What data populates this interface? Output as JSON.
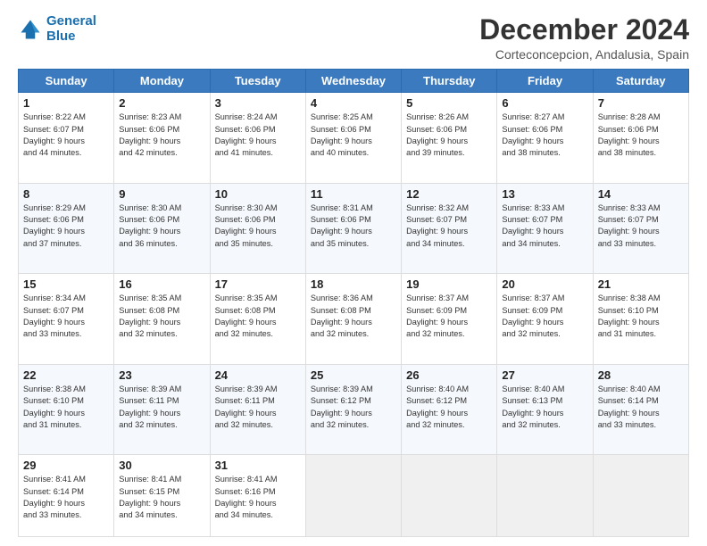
{
  "logo": {
    "line1": "General",
    "line2": "Blue"
  },
  "title": "December 2024",
  "subtitle": "Corteconcepcion, Andalusia, Spain",
  "days_of_week": [
    "Sunday",
    "Monday",
    "Tuesday",
    "Wednesday",
    "Thursday",
    "Friday",
    "Saturday"
  ],
  "weeks": [
    [
      {
        "day": "1",
        "info": "Sunrise: 8:22 AM\nSunset: 6:07 PM\nDaylight: 9 hours\nand 44 minutes."
      },
      {
        "day": "2",
        "info": "Sunrise: 8:23 AM\nSunset: 6:06 PM\nDaylight: 9 hours\nand 42 minutes."
      },
      {
        "day": "3",
        "info": "Sunrise: 8:24 AM\nSunset: 6:06 PM\nDaylight: 9 hours\nand 41 minutes."
      },
      {
        "day": "4",
        "info": "Sunrise: 8:25 AM\nSunset: 6:06 PM\nDaylight: 9 hours\nand 40 minutes."
      },
      {
        "day": "5",
        "info": "Sunrise: 8:26 AM\nSunset: 6:06 PM\nDaylight: 9 hours\nand 39 minutes."
      },
      {
        "day": "6",
        "info": "Sunrise: 8:27 AM\nSunset: 6:06 PM\nDaylight: 9 hours\nand 38 minutes."
      },
      {
        "day": "7",
        "info": "Sunrise: 8:28 AM\nSunset: 6:06 PM\nDaylight: 9 hours\nand 38 minutes."
      }
    ],
    [
      {
        "day": "8",
        "info": "Sunrise: 8:29 AM\nSunset: 6:06 PM\nDaylight: 9 hours\nand 37 minutes."
      },
      {
        "day": "9",
        "info": "Sunrise: 8:30 AM\nSunset: 6:06 PM\nDaylight: 9 hours\nand 36 minutes."
      },
      {
        "day": "10",
        "info": "Sunrise: 8:30 AM\nSunset: 6:06 PM\nDaylight: 9 hours\nand 35 minutes."
      },
      {
        "day": "11",
        "info": "Sunrise: 8:31 AM\nSunset: 6:06 PM\nDaylight: 9 hours\nand 35 minutes."
      },
      {
        "day": "12",
        "info": "Sunrise: 8:32 AM\nSunset: 6:07 PM\nDaylight: 9 hours\nand 34 minutes."
      },
      {
        "day": "13",
        "info": "Sunrise: 8:33 AM\nSunset: 6:07 PM\nDaylight: 9 hours\nand 34 minutes."
      },
      {
        "day": "14",
        "info": "Sunrise: 8:33 AM\nSunset: 6:07 PM\nDaylight: 9 hours\nand 33 minutes."
      }
    ],
    [
      {
        "day": "15",
        "info": "Sunrise: 8:34 AM\nSunset: 6:07 PM\nDaylight: 9 hours\nand 33 minutes."
      },
      {
        "day": "16",
        "info": "Sunrise: 8:35 AM\nSunset: 6:08 PM\nDaylight: 9 hours\nand 32 minutes."
      },
      {
        "day": "17",
        "info": "Sunrise: 8:35 AM\nSunset: 6:08 PM\nDaylight: 9 hours\nand 32 minutes."
      },
      {
        "day": "18",
        "info": "Sunrise: 8:36 AM\nSunset: 6:08 PM\nDaylight: 9 hours\nand 32 minutes."
      },
      {
        "day": "19",
        "info": "Sunrise: 8:37 AM\nSunset: 6:09 PM\nDaylight: 9 hours\nand 32 minutes."
      },
      {
        "day": "20",
        "info": "Sunrise: 8:37 AM\nSunset: 6:09 PM\nDaylight: 9 hours\nand 32 minutes."
      },
      {
        "day": "21",
        "info": "Sunrise: 8:38 AM\nSunset: 6:10 PM\nDaylight: 9 hours\nand 31 minutes."
      }
    ],
    [
      {
        "day": "22",
        "info": "Sunrise: 8:38 AM\nSunset: 6:10 PM\nDaylight: 9 hours\nand 31 minutes."
      },
      {
        "day": "23",
        "info": "Sunrise: 8:39 AM\nSunset: 6:11 PM\nDaylight: 9 hours\nand 32 minutes."
      },
      {
        "day": "24",
        "info": "Sunrise: 8:39 AM\nSunset: 6:11 PM\nDaylight: 9 hours\nand 32 minutes."
      },
      {
        "day": "25",
        "info": "Sunrise: 8:39 AM\nSunset: 6:12 PM\nDaylight: 9 hours\nand 32 minutes."
      },
      {
        "day": "26",
        "info": "Sunrise: 8:40 AM\nSunset: 6:12 PM\nDaylight: 9 hours\nand 32 minutes."
      },
      {
        "day": "27",
        "info": "Sunrise: 8:40 AM\nSunset: 6:13 PM\nDaylight: 9 hours\nand 32 minutes."
      },
      {
        "day": "28",
        "info": "Sunrise: 8:40 AM\nSunset: 6:14 PM\nDaylight: 9 hours\nand 33 minutes."
      }
    ],
    [
      {
        "day": "29",
        "info": "Sunrise: 8:41 AM\nSunset: 6:14 PM\nDaylight: 9 hours\nand 33 minutes."
      },
      {
        "day": "30",
        "info": "Sunrise: 8:41 AM\nSunset: 6:15 PM\nDaylight: 9 hours\nand 34 minutes."
      },
      {
        "day": "31",
        "info": "Sunrise: 8:41 AM\nSunset: 6:16 PM\nDaylight: 9 hours\nand 34 minutes."
      },
      {
        "day": "",
        "info": ""
      },
      {
        "day": "",
        "info": ""
      },
      {
        "day": "",
        "info": ""
      },
      {
        "day": "",
        "info": ""
      }
    ]
  ]
}
